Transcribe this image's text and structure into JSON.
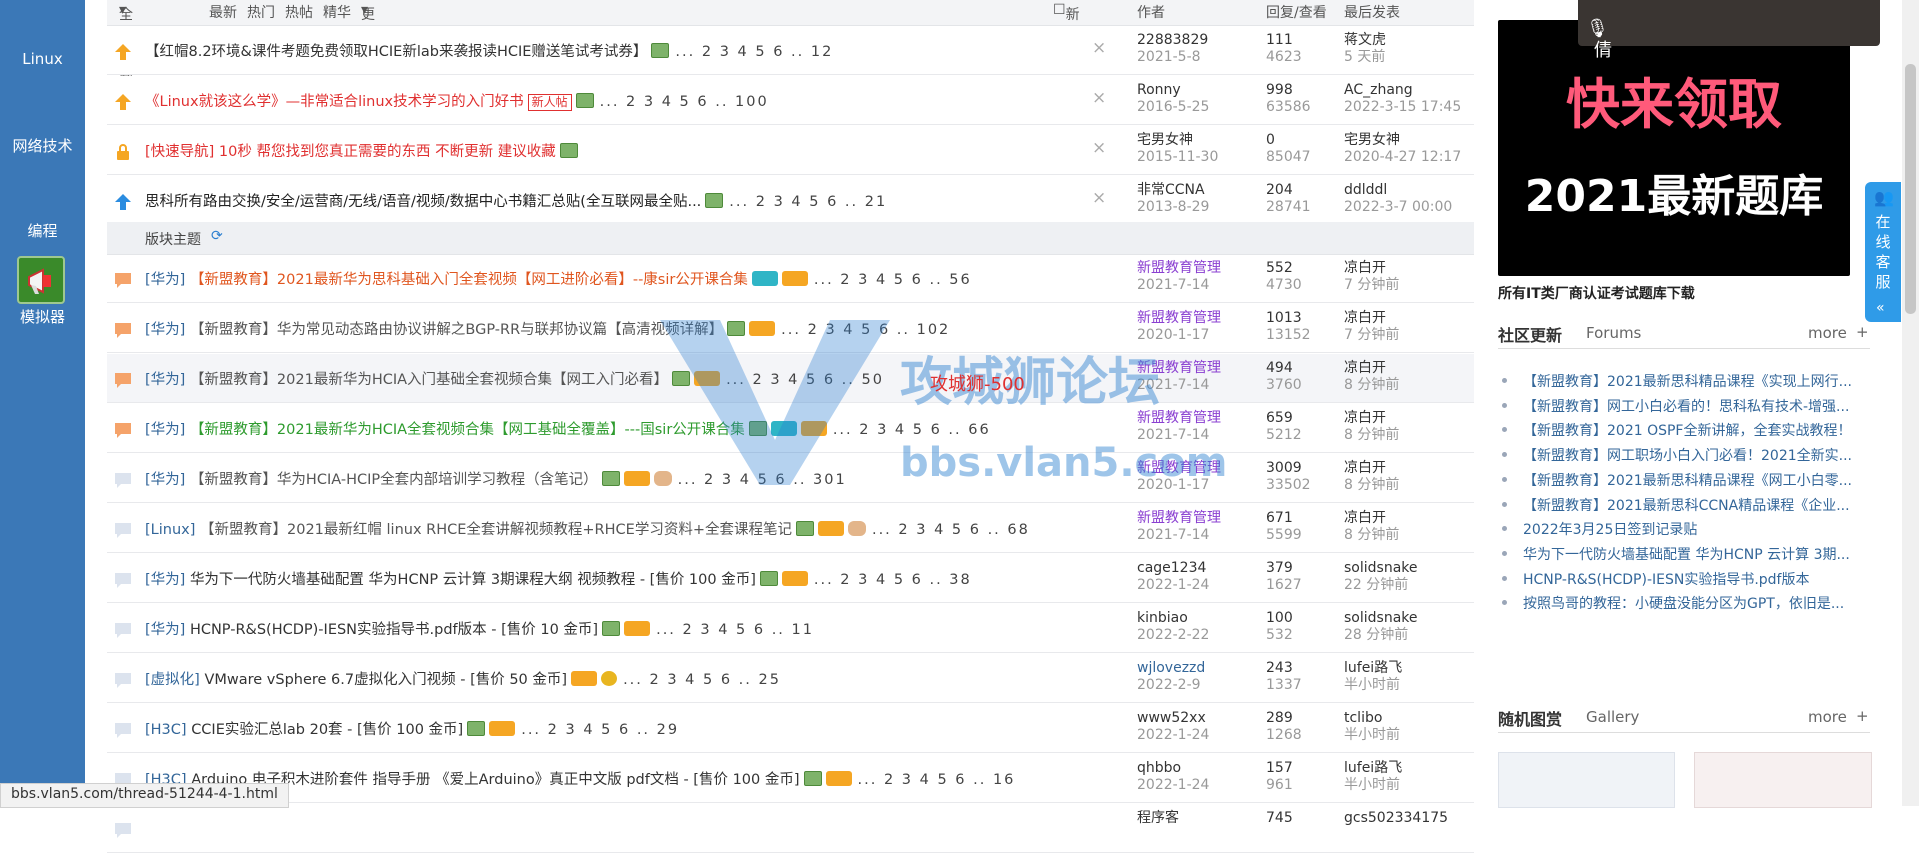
{
  "sidebar": {
    "items": [
      {
        "label": "Linux"
      },
      {
        "label": "网络技术"
      },
      {
        "label": "编程"
      },
      {
        "label": "模拟器"
      }
    ]
  },
  "filter": {
    "all_topics": "全部主题",
    "latest": "最新",
    "hot": "热门",
    "hot_posts": "热帖",
    "digest": "精华",
    "more": "更多",
    "new_window": "新窗",
    "author": "作者",
    "replies_views": "回复/查看",
    "last_post": "最后发表"
  },
  "section_label": "版块主题",
  "threads": [
    {
      "cat": "",
      "title": "【红帽8.2环境&课件考题免费领取HCIE新lab来袭报读HCIE赠送笔试考试券】",
      "title_color": "#333333",
      "new_tag": "",
      "badges": [
        "att"
      ],
      "pages": "... 2 3 4 5 6 .. 12",
      "author": "22883829",
      "author_date": "2021-5-8",
      "author_style": "n",
      "replies": "111",
      "views": "4623",
      "last_user": "蒋文虎",
      "last_time": "5 天前",
      "icon": "up-orange"
    },
    {
      "cat": "",
      "title": "《Linux就该这么学》—非常适合linux技术学习的入门好书",
      "title_color": "#e03030",
      "new_tag": "新人帖",
      "badges": [
        "att"
      ],
      "pages": "... 2 3 4 5 6 .. 100",
      "author": "Ronny",
      "author_date": "2016-5-25",
      "author_style": "n",
      "replies": "998",
      "views": "63586",
      "last_user": "AC_zhang",
      "last_time": "2022-3-15 17:45",
      "icon": "up-orange"
    },
    {
      "cat": "",
      "title": "[快速导航] 10秒 帮您找到您真正需要的东西 不断更新 建议收藏",
      "title_color": "#e03030",
      "new_tag": "",
      "badges": [
        "att"
      ],
      "pages": "",
      "author": "宅男女神",
      "author_date": "2015-11-30",
      "author_style": "n",
      "replies": "0",
      "views": "85047",
      "last_user": "宅男女神",
      "last_time": "2020-4-27 12:17",
      "icon": "lock"
    },
    {
      "cat": "",
      "title": "思科所有路由交换/安全/运营商/无线/语音/视频/数据中心书籍汇总贴(全互联网最全贴...",
      "title_color": "#222222",
      "new_tag": "",
      "badges": [
        "att"
      ],
      "pages": "... 2 3 4 5 6 .. 21",
      "author": "非常CCNA",
      "author_date": "2013-8-29",
      "author_style": "n",
      "replies": "204",
      "views": "28741",
      "last_user": "ddlddl",
      "last_time": "2022-3-7 00:00",
      "icon": "up-blue"
    },
    {
      "cat": "[华为]",
      "title": "【新盟教育】2021最新华为思科基础入门全套视频【网工进阶必看】--康sir公开课合集",
      "title_color": "#e0561f",
      "new_tag": "",
      "badges": [
        "rec",
        "hot"
      ],
      "pages": "... 2 3 4 5 6 .. 56",
      "author": "新盟教育管理",
      "author_date": "2021-7-14",
      "author_style": "m",
      "replies": "552",
      "views": "4730",
      "last_user": "凉白开",
      "last_time": "7 分钟前",
      "icon": "chat-orange"
    },
    {
      "cat": "[华为]",
      "title": "【新盟教育】华为常见动态路由协议讲解之BGP-RR与联邦协议篇【高清视频详解】",
      "title_color": "#555555",
      "new_tag": "",
      "badges": [
        "att",
        "hot"
      ],
      "pages": "... 2 3 4 5 6 .. 102",
      "author": "新盟教育管理",
      "author_date": "2020-1-17",
      "author_style": "m",
      "replies": "1013",
      "views": "13152",
      "last_user": "凉白开",
      "last_time": "7 分钟前",
      "icon": "chat-orange"
    },
    {
      "cat": "[华为]",
      "title": "【新盟教育】2021最新华为HCIA入门基础全套视频合集【网工入门必看】",
      "title_color": "#555555",
      "new_tag": "",
      "badges": [
        "att",
        "hot"
      ],
      "pages": "... 2 3 4 5 6 .. 50",
      "author": "新盟教育管理",
      "author_date": "2021-7-14",
      "author_style": "m",
      "replies": "494",
      "views": "3760",
      "last_user": "凉白开",
      "last_time": "8 分钟前",
      "icon": "chat-orange"
    },
    {
      "cat": "[华为]",
      "title": "【新盟教育】2021最新华为HCIA全套视频合集【网工基础全覆盖】---国sir公开课合集",
      "title_color": "#2e9b2e",
      "new_tag": "",
      "badges": [
        "att",
        "rec",
        "hot"
      ],
      "pages": "... 2 3 4 5 6 .. 66",
      "author": "新盟教育管理",
      "author_date": "2021-7-14",
      "author_style": "m",
      "replies": "659",
      "views": "5212",
      "last_user": "凉白开",
      "last_time": "8 分钟前",
      "icon": "chat-orange"
    },
    {
      "cat": "[华为]",
      "title": "【新盟教育】华为HCIA-HCIP全套内部培训学习教程（含笔记）",
      "title_color": "#555555",
      "new_tag": "",
      "badges": [
        "att",
        "hot",
        "hand"
      ],
      "pages": "... 2 3 4 5 6 .. 301",
      "author": "新盟教育管理",
      "author_date": "2020-1-17",
      "author_style": "m",
      "replies": "3009",
      "views": "33502",
      "last_user": "凉白开",
      "last_time": "8 分钟前",
      "icon": "chat-grey"
    },
    {
      "cat": "[Linux]",
      "title": "【新盟教育】2021最新红帽 linux RHCE全套讲解视频教程+RHCE学习资料+全套课程笔记",
      "title_color": "#555555",
      "new_tag": "",
      "badges": [
        "att",
        "hot",
        "hand"
      ],
      "pages": "... 2 3 4 5 6 .. 68",
      "author": "新盟教育管理",
      "author_date": "2021-7-14",
      "author_style": "m",
      "replies": "671",
      "views": "5599",
      "last_user": "凉白开",
      "last_time": "8 分钟前",
      "icon": "chat-grey"
    },
    {
      "cat": "[华为]",
      "title": "华为下一代防火墙基础配置 华为HCNP 云计算 3期课程大纲 视频教程 - [售价 100 金币]",
      "title_color": "#333333",
      "new_tag": "",
      "badges": [
        "att",
        "hot"
      ],
      "pages": "... 2 3 4 5 6 .. 38",
      "author": "cage1234",
      "author_date": "2022-1-24",
      "author_style": "n",
      "replies": "379",
      "views": "1627",
      "last_user": "solidsnake",
      "last_time": "22 分钟前",
      "icon": "chat-grey"
    },
    {
      "cat": "[华为]",
      "title": "HCNP-R&S(HCDP)-IESN实验指导书.pdf版本 - [售价 10 金币]",
      "title_color": "#333333",
      "new_tag": "",
      "badges": [
        "att",
        "hot"
      ],
      "pages": "... 2 3 4 5 6 .. 11",
      "author": "kinbiao",
      "author_date": "2022-2-22",
      "author_style": "n",
      "replies": "100",
      "views": "532",
      "last_user": "solidsnake",
      "last_time": "28 分钟前",
      "icon": "chat-grey"
    },
    {
      "cat": "[虚拟化]",
      "title": "VMware vSphere 6.7虚拟化入门视频 - [售价 50 金币]",
      "title_color": "#333333",
      "new_tag": "",
      "badges": [
        "hot",
        "coin"
      ],
      "pages": "... 2 3 4 5 6 .. 25",
      "author": "wjlovezzd",
      "author_date": "2022-2-9",
      "author_style": "b",
      "replies": "243",
      "views": "1337",
      "last_user": "lufei路飞",
      "last_time": "半小时前",
      "icon": "chat-grey"
    },
    {
      "cat": "[H3C]",
      "title": "CCIE实验汇总lab 20套 - [售价 100 金币]",
      "title_color": "#333333",
      "new_tag": "",
      "badges": [
        "att",
        "hot"
      ],
      "pages": "... 2 3 4 5 6 .. 29",
      "author": "www52xx",
      "author_date": "2022-1-24",
      "author_style": "n",
      "replies": "289",
      "views": "1268",
      "last_user": "tclibo",
      "last_time": "半小时前",
      "icon": "chat-grey"
    },
    {
      "cat": "[H3C]",
      "title": "Arduino 电子积木进阶套件 指导手册 《爱上Arduino》真正中文版 pdf文档 - [售价 100 金币]",
      "title_color": "#333333",
      "new_tag": "",
      "badges": [
        "att",
        "hot"
      ],
      "pages": "... 2 3 4 5 6 .. 16",
      "author": "qhbbo",
      "author_date": "2022-1-24",
      "author_style": "n",
      "replies": "157",
      "views": "961",
      "last_user": "lufei路飞",
      "last_time": "半小时前",
      "icon": "chat-grey"
    },
    {
      "cat": "",
      "title": "",
      "title_color": "#333333",
      "new_tag": "",
      "badges": [],
      "pages": "",
      "author": "程序客",
      "author_date": "",
      "author_style": "n",
      "replies": "745",
      "views": "",
      "last_user": "gcs502334175",
      "last_time": "",
      "icon": "chat-grey"
    }
  ],
  "right": {
    "camera_label": "倩",
    "promo_line1": "快来领取",
    "promo_line2": "2021最新题库",
    "promo_caption": "所有IT类厂商认证考试题库下载",
    "community_title": "社区更新",
    "community_sub": "Forums",
    "community_more": "more",
    "community_plus": "+",
    "community_items": [
      "【新盟教育】2021最新思科精品课程《实现上网行...",
      "【新盟教育】网工小白必看的！思科私有技术-增强...",
      "【新盟教育】2021 OSPF全新讲解，全套实战教程！",
      "【新盟教育】网工职场小白入门必看！2021全新实...",
      "【新盟教育】2021最新思科精品课程《网工小白零...",
      "【新盟教育】2021最新思科CCNA精品课程《企业...",
      "2022年3月25日签到记录贴",
      "华为下一代防火墙基础配置 华为HCNP 云计算 3期...",
      "HCNP-R&S(HCDP)-IESN实验指导书.pdf版本",
      "按照鸟哥的教程：小硬盘没能分区为GPT，依旧是..."
    ],
    "gallery_title": "随机图赏",
    "gallery_sub": "Gallery",
    "gallery_more": "more",
    "gallery_plus": "+",
    "service_label": "在线客服"
  },
  "watermark": {
    "big": "攻城狮论坛",
    "url": "bbs.vlan5.com",
    "tag": "攻城狮-500"
  },
  "statusbar_url": "bbs.vlan5.com/thread-51244-4-1.html",
  "colors": {
    "sidebar": "#3b78b7",
    "link": "#336699",
    "accent_red": "#e03030"
  }
}
